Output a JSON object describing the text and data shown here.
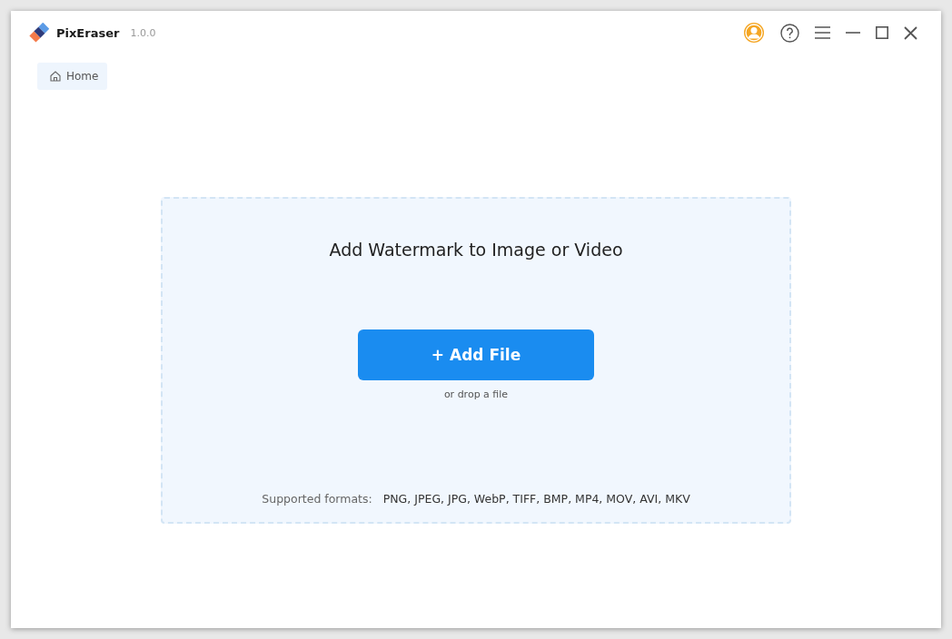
{
  "window": {
    "title": "PixEraser",
    "version": "1.0.0"
  },
  "tabs": [
    {
      "label": "Home",
      "selected": true
    }
  ],
  "dropzone": {
    "heading": "Add Watermark to Image or Video",
    "button": "+ Add File",
    "hint": "or drop a file",
    "formats_label": "Supported formats:",
    "formats": "PNG, JPEG, JPG, WebP, TIFF, BMP, MP4, MOV, AVI, MKV"
  }
}
